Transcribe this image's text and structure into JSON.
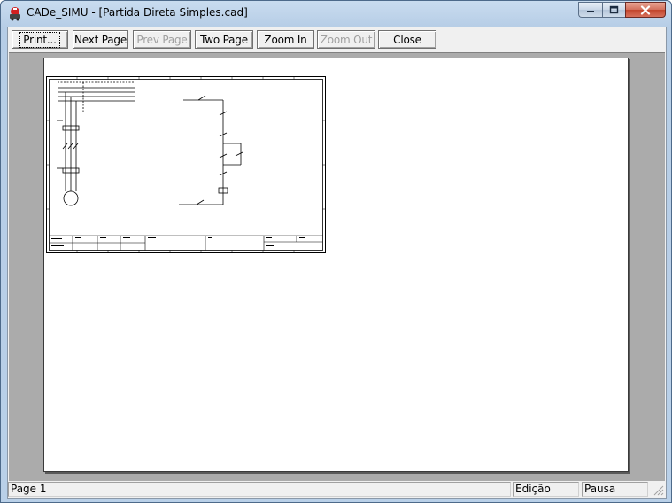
{
  "window": {
    "title": "CADe_SIMU - [Partida Direta Simples.cad]"
  },
  "toolbar": {
    "print_label": "Print...",
    "next_page_label": "Next Page",
    "prev_page_label": "Prev Page",
    "two_page_label": "Two Page",
    "zoom_in_label": "Zoom In",
    "zoom_out_label": "Zoom Out",
    "close_label": "Close",
    "prev_page_enabled": false,
    "zoom_out_enabled": false
  },
  "statusbar": {
    "page": "Page 1",
    "mode": "Edição",
    "state": "Pausa"
  },
  "colors": {
    "close_button": "#c2452c",
    "preview_background": "#ababab",
    "page": "#ffffff"
  }
}
